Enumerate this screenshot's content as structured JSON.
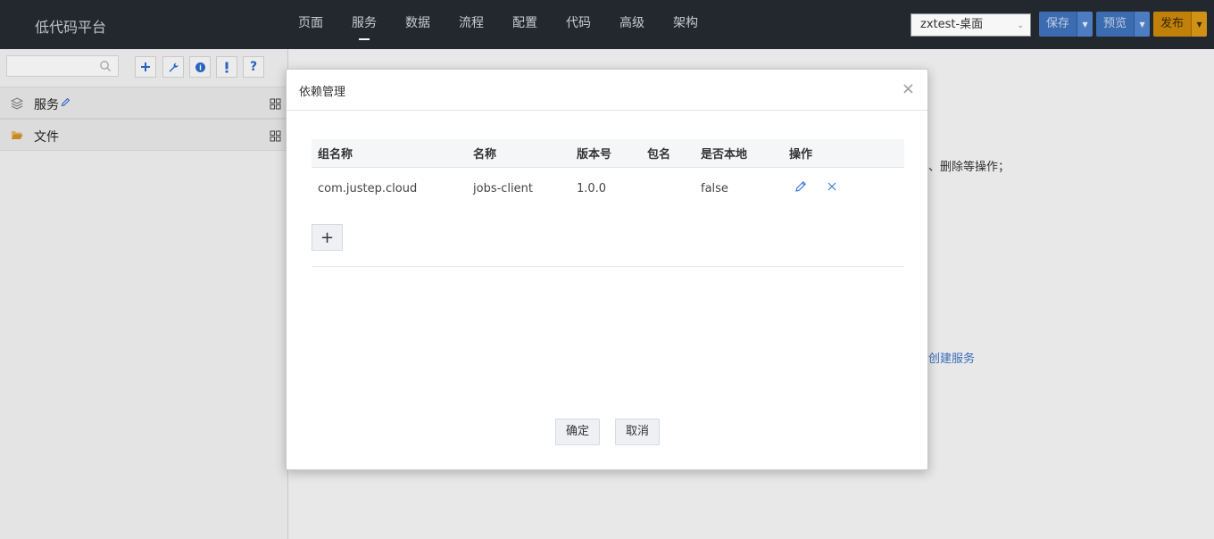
{
  "app": {
    "title": "低代码平台"
  },
  "nav": {
    "items": [
      {
        "label": "页面"
      },
      {
        "label": "服务",
        "active": true
      },
      {
        "label": "数据"
      },
      {
        "label": "流程"
      },
      {
        "label": "配置"
      },
      {
        "label": "代码"
      },
      {
        "label": "高级"
      },
      {
        "label": "架构"
      }
    ]
  },
  "header": {
    "app_select_value": "zxtest-桌面",
    "save_label": "保存",
    "preview_label": "预览",
    "publish_label": "发布"
  },
  "sidebar": {
    "search_placeholder": "",
    "tools": [
      "plus-icon",
      "wrench-icon",
      "info-circle-icon",
      "exclamation-icon",
      "question-icon"
    ],
    "tree": [
      {
        "label": "服务",
        "icon": "layers-icon"
      },
      {
        "label": "文件",
        "icon": "folder-open-icon"
      }
    ]
  },
  "background": {
    "text_fragment": "、删除等操作；",
    "link_fragment": "创建服务"
  },
  "dialog": {
    "title": "依赖管理",
    "columns": [
      "组名称",
      "名称",
      "版本号",
      "包名",
      "是否本地",
      "操作"
    ],
    "rows": [
      {
        "group": "com.justep.cloud",
        "name": "jobs-client",
        "version": "1.0.0",
        "package": "",
        "local": "false"
      }
    ],
    "add_label": "+",
    "ok_label": "确定",
    "cancel_label": "取消"
  },
  "colors": {
    "topbar": "#252a31",
    "accent_blue": "#3d6fb6",
    "publish_gold": "#c8860a",
    "link_blue": "#3b6fc2"
  }
}
